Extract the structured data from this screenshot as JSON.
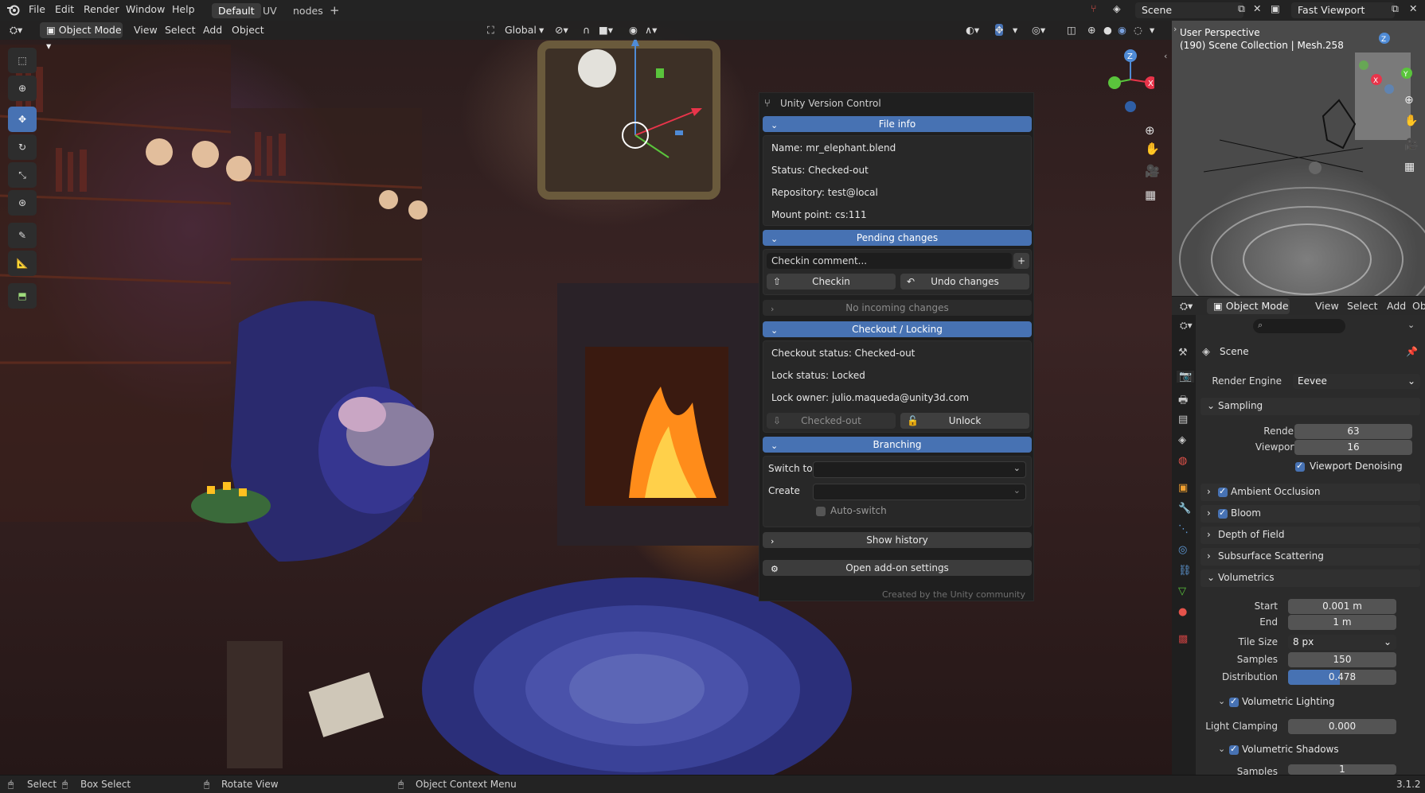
{
  "topbar": {
    "menus": [
      "File",
      "Edit",
      "Render",
      "Window",
      "Help"
    ],
    "workspaces": [
      "Default",
      "UV",
      "nodes"
    ],
    "active_workspace": "Default",
    "add_workspace": "+",
    "scene_label": "Scene",
    "viewlayer_label": "Fast Viewport"
  },
  "viewport_header": {
    "mode": "Object Mode",
    "menus": [
      "View",
      "Select",
      "Add",
      "Object"
    ],
    "transform_orientation": "Global"
  },
  "toolbar": [
    "select-box",
    "cursor",
    "move",
    "rotate",
    "scale",
    "transform",
    "annotate",
    "measure",
    "add-cube"
  ],
  "uvc": {
    "title": "Unity Version Control",
    "file_info": {
      "header": "File info",
      "name": "Name: mr_elephant.blend",
      "status": "Status: Checked-out",
      "repository": "Repository: test@local",
      "mount_point": "Mount point: cs:111"
    },
    "pending": {
      "header": "Pending changes",
      "comment_placeholder": "Checkin comment...",
      "add": "+",
      "checkin": "Checkin",
      "undo": "Undo changes",
      "incoming": "No incoming changes"
    },
    "locking": {
      "header": "Checkout / Locking",
      "checkout_status": "Checkout status: Checked-out",
      "lock_status": "Lock status: Locked",
      "lock_owner": "Lock owner: julio.maqueda@unity3d.com",
      "checked_out_btn": "Checked-out",
      "unlock_btn": "Unlock"
    },
    "branching": {
      "header": "Branching",
      "switch_to": "Switch to",
      "create": "Create",
      "auto_switch": "Auto-switch",
      "show_history": "Show history"
    },
    "settings": "Open add-on settings",
    "credit": "Created by the Unity community"
  },
  "mini_viewport": {
    "title": "User Perspective",
    "subtitle": "(190) Scene Collection | Mesh.258",
    "header_mode": "Object Mode",
    "header_menus": [
      "View",
      "Select",
      "Add",
      "Obje"
    ]
  },
  "properties": {
    "scene_title": "Scene",
    "render_engine_label": "Render Engine",
    "render_engine": "Eevee",
    "sampling": {
      "header": "Sampling",
      "render_label": "Render",
      "render": "63",
      "viewport_label": "Viewport",
      "viewport": "16",
      "denoise": "Viewport Denoising"
    },
    "panels": [
      "Ambient Occlusion",
      "Bloom",
      "Depth of Field",
      "Subsurface Scattering"
    ],
    "volumetrics": {
      "header": "Volumetrics",
      "start_label": "Start",
      "start": "0.001 m",
      "end_label": "End",
      "end": "1 m",
      "tile_label": "Tile Size",
      "tile": "8 px",
      "samples_label": "Samples",
      "samples": "150",
      "dist_label": "Distribution",
      "dist": "0.478",
      "dist_fraction": 0.478,
      "vol_lighting": "Volumetric Lighting",
      "clamp_label": "Light Clamping",
      "clamp": "0.000",
      "vol_shadows": "Volumetric Shadows",
      "shadow_samples_label": "Samples",
      "shadow_samples": "1"
    }
  },
  "statusbar": {
    "select": "Select",
    "box_select": "Box Select",
    "rotate": "Rotate View",
    "context": "Object Context Menu",
    "version": "3.1.2"
  },
  "colors": {
    "accent": "#4772b3",
    "panel_bg": "#1f1f1f",
    "field": "#545454"
  }
}
